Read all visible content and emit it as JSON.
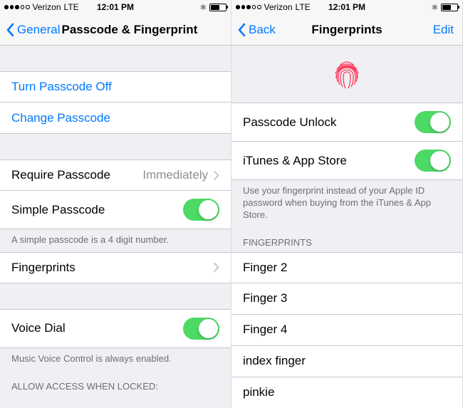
{
  "status": {
    "carrier": "Verizon",
    "network": "LTE",
    "time": "12:01 PM"
  },
  "left": {
    "back_label": "General",
    "title": "Passcode & Fingerprint",
    "turn_off": "Turn Passcode Off",
    "change": "Change Passcode",
    "require_label": "Require Passcode",
    "require_value": "Immediately",
    "simple_label": "Simple Passcode",
    "simple_footer": "A simple passcode is a 4 digit number.",
    "fingerprints_label": "Fingerprints",
    "voice_dial_label": "Voice Dial",
    "voice_footer": "Music Voice Control is always enabled.",
    "allow_header": "ALLOW ACCESS WHEN LOCKED:"
  },
  "right": {
    "back_label": "Back",
    "title": "Fingerprints",
    "edit_label": "Edit",
    "passcode_unlock": "Passcode Unlock",
    "itunes": "iTunes & App Store",
    "itunes_footer": "Use your fingerprint instead of your Apple ID password when buying from the iTunes & App Store.",
    "fingerprints_header": "FINGERPRINTS",
    "fingers": [
      "Finger 2",
      "Finger 3",
      "Finger 4",
      "index finger",
      "pinkie"
    ]
  }
}
